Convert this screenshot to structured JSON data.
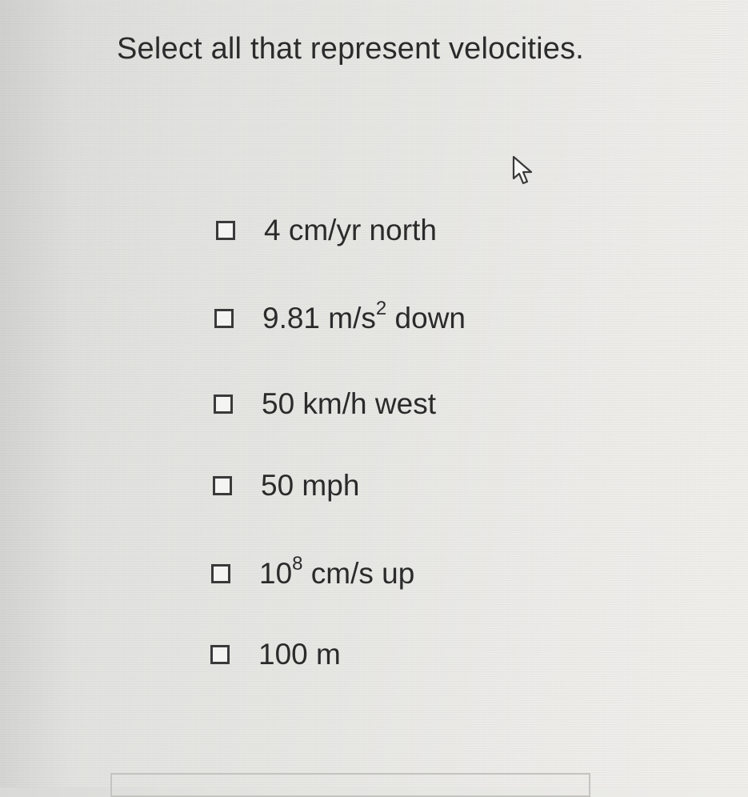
{
  "question": {
    "text": "Select all that represent velocities."
  },
  "options": [
    {
      "text": "4 cm/yr north",
      "checked": false
    },
    {
      "pre": "9.81 m/s",
      "sup": "2",
      "post": " down",
      "checked": false
    },
    {
      "text": "50 km/h west",
      "checked": false
    },
    {
      "text": "50 mph",
      "checked": false
    },
    {
      "pre": "10",
      "sup": "8",
      "post": " cm/s up",
      "checked": false
    },
    {
      "text": "100 m",
      "checked": false
    }
  ],
  "icons": {
    "checkbox": "empty-square-checkbox",
    "cursor": "hand-pointer-cursor"
  }
}
